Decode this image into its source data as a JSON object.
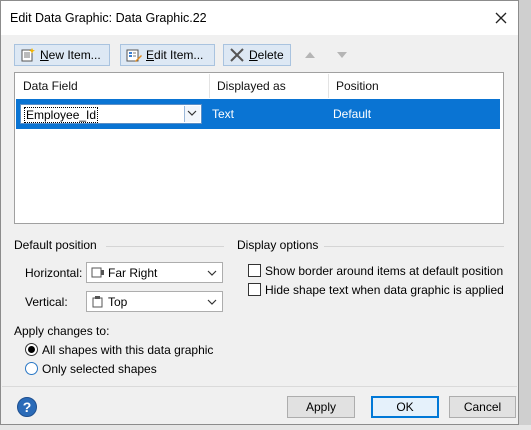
{
  "dialog": {
    "title": "Edit Data Graphic: Data Graphic.22"
  },
  "toolbar": {
    "new_prefix": "N",
    "new_rest": "ew Item...",
    "edit_prefix": "E",
    "edit_rest": "dit Item...",
    "delete_prefix": "D",
    "delete_rest": "elete"
  },
  "grid": {
    "columns": [
      "Data Field",
      "Displayed as",
      "Position"
    ],
    "rows": [
      {
        "data_field": "Employee_Id",
        "displayed_as": "Text",
        "position": "Default"
      }
    ]
  },
  "default_position": {
    "label": "Default position",
    "horizontal_label": "Horizontal:",
    "horizontal_value": "Far Right",
    "vertical_label": "Vertical:",
    "vertical_value": "Top"
  },
  "display_options": {
    "label": "Display options",
    "show_border": "Show border around items at default position",
    "show_border_checked": false,
    "hide_text": "Hide shape text when data graphic is applied",
    "hide_text_checked": false
  },
  "apply_changes": {
    "label": "Apply changes to:",
    "option_all": "All shapes with this data graphic",
    "option_selected": "Only selected shapes",
    "selected": "all"
  },
  "buttons": {
    "apply": "Apply",
    "ok": "OK",
    "cancel": "Cancel"
  },
  "colors": {
    "selection": "#0a74d3",
    "accent": "#0078d7",
    "help": "#2b6bb8"
  }
}
